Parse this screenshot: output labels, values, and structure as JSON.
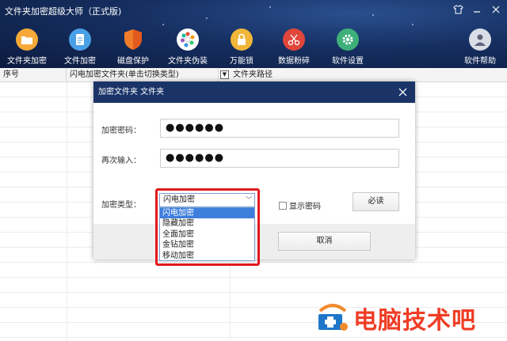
{
  "app": {
    "title": "文件夹加密超级大师（正式版)"
  },
  "toolbar": [
    {
      "label": "文件夹加密",
      "icon": "folder-icon",
      "color": "#f0a23a"
    },
    {
      "label": "文件加密",
      "icon": "document-icon",
      "color": "#4aa0e6"
    },
    {
      "label": "磁盘保护",
      "icon": "shield-icon",
      "color": "#f07d2a"
    },
    {
      "label": "文件夹伪装",
      "icon": "pie-icon",
      "color": "#ffffff"
    },
    {
      "label": "万能锁",
      "icon": "lock-icon",
      "color": "#f0b63a"
    },
    {
      "label": "数据粉碎",
      "icon": "scissors-icon",
      "color": "#e0463a"
    },
    {
      "label": "软件设置",
      "icon": "gear-icon",
      "color": "#3db07a"
    },
    {
      "label": "软件帮助",
      "icon": "user-icon",
      "color": "#d9dde6"
    }
  ],
  "table": {
    "headers": [
      "序号",
      "闪电加密文件夹(单击切换类型)",
      "文件夹路径"
    ]
  },
  "dialog": {
    "title": "加密文件夹 文件夹",
    "password_label": "加密密码：",
    "password_value": "●●●●●●",
    "confirm_label": "再次输入：",
    "confirm_value": "●●●●●●",
    "type_label": "加密类型：",
    "type_selected": "闪电加密",
    "type_options": [
      "闪电加密",
      "隐藏加密",
      "全面加密",
      "金钻加密",
      "移动加密"
    ],
    "show_password_label": "显示密码",
    "read_button": "必读",
    "cancel_button": "取消"
  },
  "watermark": {
    "text": "电脑技术吧"
  }
}
